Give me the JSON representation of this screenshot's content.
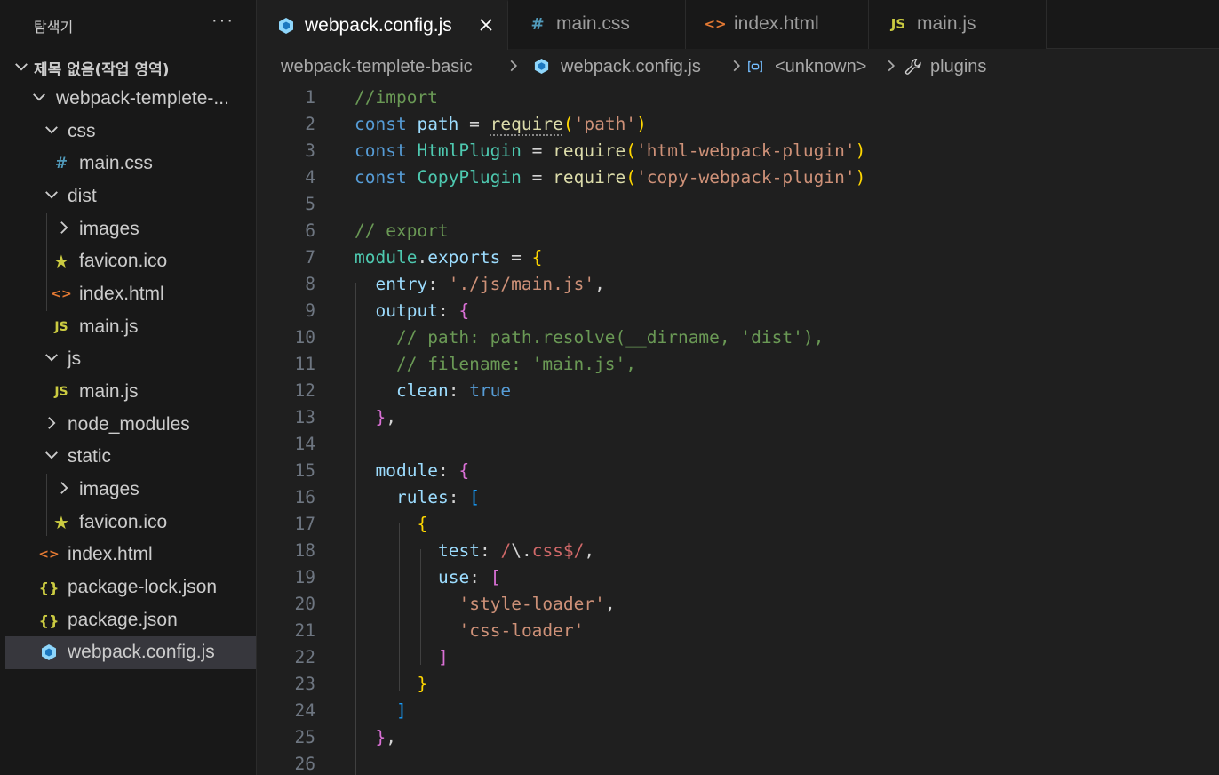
{
  "sidebar": {
    "title": "탐색기",
    "more": "···",
    "root_label": "제목 없음(작업 영역)",
    "items": [
      {
        "label": "webpack-templete-...",
        "kind": "folder-open"
      },
      {
        "label": "css",
        "kind": "folder-open"
      },
      {
        "label": "main.css",
        "kind": "css-file",
        "icon": "#"
      },
      {
        "label": "dist",
        "kind": "folder-open"
      },
      {
        "label": "images",
        "kind": "folder-closed"
      },
      {
        "label": "favicon.ico",
        "kind": "ico-file",
        "icon": "★"
      },
      {
        "label": "index.html",
        "kind": "html-file",
        "icon": "<>"
      },
      {
        "label": "main.js",
        "kind": "js-file",
        "icon": "JS"
      },
      {
        "label": "js",
        "kind": "folder-open"
      },
      {
        "label": "main.js",
        "kind": "js-file",
        "icon": "JS"
      },
      {
        "label": "node_modules",
        "kind": "folder-closed"
      },
      {
        "label": "static",
        "kind": "folder-open"
      },
      {
        "label": "images",
        "kind": "folder-closed"
      },
      {
        "label": "favicon.ico",
        "kind": "ico-file",
        "icon": "★"
      },
      {
        "label": "index.html",
        "kind": "html-file",
        "icon": "<>"
      },
      {
        "label": "package-lock.json",
        "kind": "json-file",
        "icon": "{}"
      },
      {
        "label": "package.json",
        "kind": "json-file",
        "icon": "{}"
      },
      {
        "label": "webpack.config.js",
        "kind": "webpack-file",
        "selected": true
      }
    ]
  },
  "tabs": [
    {
      "label": "webpack.config.js",
      "active": true,
      "icon": "webpack-icon"
    },
    {
      "label": "main.css",
      "active": false,
      "icon": "#"
    },
    {
      "label": "index.html",
      "active": false,
      "icon": "<>"
    },
    {
      "label": "main.js",
      "active": false,
      "icon": "JS"
    }
  ],
  "breadcrumb": {
    "folder": "webpack-templete-basic",
    "file": "webpack.config.js",
    "symbol1": "<unknown>",
    "symbol2": "plugins"
  },
  "editor": {
    "line_numbers": [
      "1",
      "2",
      "3",
      "4",
      "5",
      "6",
      "7",
      "8",
      "9",
      "10",
      "11",
      "12",
      "13",
      "14",
      "15",
      "16",
      "17",
      "18",
      "19",
      "20",
      "21",
      "22",
      "23",
      "24",
      "25",
      "26"
    ],
    "lines": [
      "//import",
      "const path = require('path')",
      "const HtmlPlugin = require('html-webpack-plugin')",
      "const CopyPlugin = require('copy-webpack-plugin')",
      "",
      "// export",
      "module.exports = {",
      "  entry: './js/main.js',",
      "  output: {",
      "    // path: path.resolve(__dirname, 'dist'),",
      "    // filename: 'main.js',",
      "    clean: true",
      "  },",
      "",
      "  module: {",
      "    rules: [",
      "      {",
      "        test: /\\.css$/,",
      "        use: [",
      "          'style-loader',",
      "          'css-loader'",
      "        ]",
      "      }",
      "    ]",
      "  },",
      ""
    ]
  },
  "colors": {
    "background": "#1f1f1f",
    "sidebar": "#181818",
    "selection": "#37373d",
    "comment": "#6a9955",
    "keyword": "#569cd6",
    "string": "#ce9178"
  }
}
